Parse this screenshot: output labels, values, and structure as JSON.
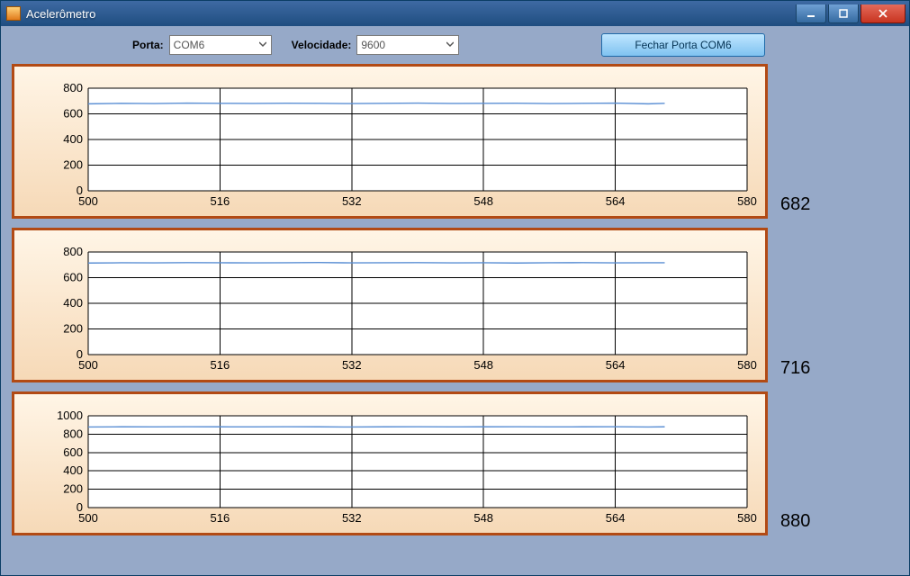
{
  "window": {
    "title": "Acelerômetro"
  },
  "controls": {
    "port_label": "Porta:",
    "port_value": "COM6",
    "speed_label": "Velocidade:",
    "speed_value": "9600",
    "action_button": "Fechar Porta COM6"
  },
  "charts": [
    {
      "readout": "682"
    },
    {
      "readout": "716"
    },
    {
      "readout": "880"
    }
  ],
  "chart_data": [
    {
      "type": "line",
      "title": "",
      "xlabel": "",
      "ylabel": "",
      "xlim": [
        500,
        580
      ],
      "ylim": [
        0,
        800
      ],
      "x_ticks": [
        500,
        516,
        532,
        548,
        564,
        580
      ],
      "y_ticks": [
        0,
        200,
        400,
        600,
        800
      ],
      "x": [
        500,
        504,
        508,
        512,
        516,
        520,
        524,
        528,
        532,
        536,
        540,
        544,
        548,
        552,
        556,
        560,
        564,
        568,
        570
      ],
      "values": [
        678,
        682,
        680,
        684,
        682,
        681,
        683,
        682,
        680,
        682,
        684,
        681,
        682,
        683,
        680,
        682,
        684,
        678,
        682
      ],
      "current_value": 682
    },
    {
      "type": "line",
      "title": "",
      "xlabel": "",
      "ylabel": "",
      "xlim": [
        500,
        580
      ],
      "ylim": [
        0,
        800
      ],
      "x_ticks": [
        500,
        516,
        532,
        548,
        564,
        580
      ],
      "y_ticks": [
        0,
        200,
        400,
        600,
        800
      ],
      "x": [
        500,
        504,
        508,
        512,
        516,
        520,
        524,
        528,
        532,
        536,
        540,
        544,
        548,
        552,
        556,
        560,
        564,
        568,
        570
      ],
      "values": [
        714,
        716,
        715,
        717,
        716,
        715,
        716,
        718,
        715,
        716,
        717,
        715,
        716,
        714,
        716,
        717,
        715,
        716,
        716
      ],
      "current_value": 716
    },
    {
      "type": "line",
      "title": "",
      "xlabel": "",
      "ylabel": "",
      "xlim": [
        500,
        580
      ],
      "ylim": [
        0,
        1000
      ],
      "x_ticks": [
        500,
        516,
        532,
        548,
        564,
        580
      ],
      "y_ticks": [
        0,
        200,
        400,
        600,
        800,
        1000
      ],
      "x": [
        500,
        504,
        508,
        512,
        516,
        520,
        524,
        528,
        532,
        536,
        540,
        544,
        548,
        552,
        556,
        560,
        564,
        568,
        570
      ],
      "values": [
        878,
        880,
        879,
        881,
        880,
        879,
        881,
        880,
        878,
        880,
        881,
        879,
        880,
        881,
        879,
        880,
        881,
        878,
        880
      ],
      "current_value": 880
    }
  ]
}
